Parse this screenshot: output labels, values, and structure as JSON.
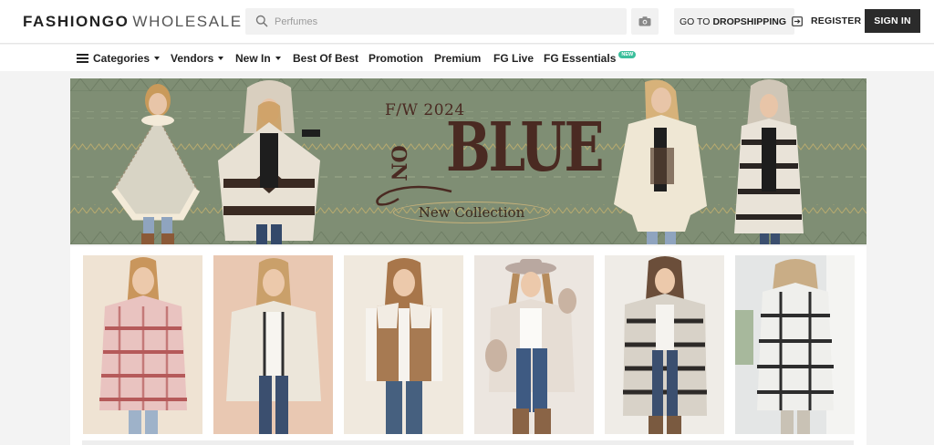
{
  "header": {
    "logo_brand": "FASHIONGO",
    "logo_sub": "WHOLESALE",
    "search_placeholder": "Perfumes",
    "dropshipping_prefix": "GO TO",
    "dropshipping_bold": "DROPSHIPPING",
    "register_label": "REGISTER",
    "signin_label": "SIGN IN",
    "icons": {
      "search": "search-icon",
      "camera": "camera-icon",
      "external": "external-link-icon"
    }
  },
  "nav": {
    "items": [
      {
        "label": "Categories",
        "dropdown": true,
        "menu_icon": true
      },
      {
        "label": "Vendors",
        "dropdown": true
      },
      {
        "label": "New In",
        "dropdown": true
      },
      {
        "label": "Best Of Best"
      },
      {
        "label": "Promotion"
      },
      {
        "label": "Premium"
      },
      {
        "label": "FG Live"
      },
      {
        "label": "FG Essentials",
        "badge": "NEW"
      }
    ]
  },
  "banner": {
    "season": "F/W 2024",
    "on_word": "ON",
    "blue_word": "BLUE",
    "subtitle": "New Collection",
    "colors": {
      "background": "#7f8e74",
      "text": "#4a2a22",
      "accent": "#c8b27a"
    }
  },
  "products": [
    {
      "name": "plaid-shacket",
      "bg": "#efe3d3",
      "top": "#e9c3c0",
      "stripe": "#b55a5a",
      "pants": "#9eb2c9"
    },
    {
      "name": "cream-fuzzy-cardigan",
      "bg": "#e9c8b2",
      "top": "#ece6da",
      "stripe": "#2f2f2f",
      "pants": "#3b4f6f"
    },
    {
      "name": "sherpa-suede-vest",
      "bg": "#f0e9de",
      "top": "#a77a52",
      "stripe": "#f2ece3",
      "pants": "#46607f"
    },
    {
      "name": "faux-fur-trim-coat",
      "bg": "#ece6e0",
      "top": "#e6ddd4",
      "stripe": "#c9b3a2",
      "pants": "#3e5a82"
    },
    {
      "name": "aztec-hooded-cardigan",
      "bg": "#efece7",
      "top": "#d8d2c8",
      "stripe": "#2d2a28",
      "pants": "#3b4f6f"
    },
    {
      "name": "striped-hooded-cardigan",
      "bg": "#e4e6e6",
      "top": "#efefec",
      "stripe": "#2d2d2d",
      "pants": "#c9c2b5"
    }
  ]
}
